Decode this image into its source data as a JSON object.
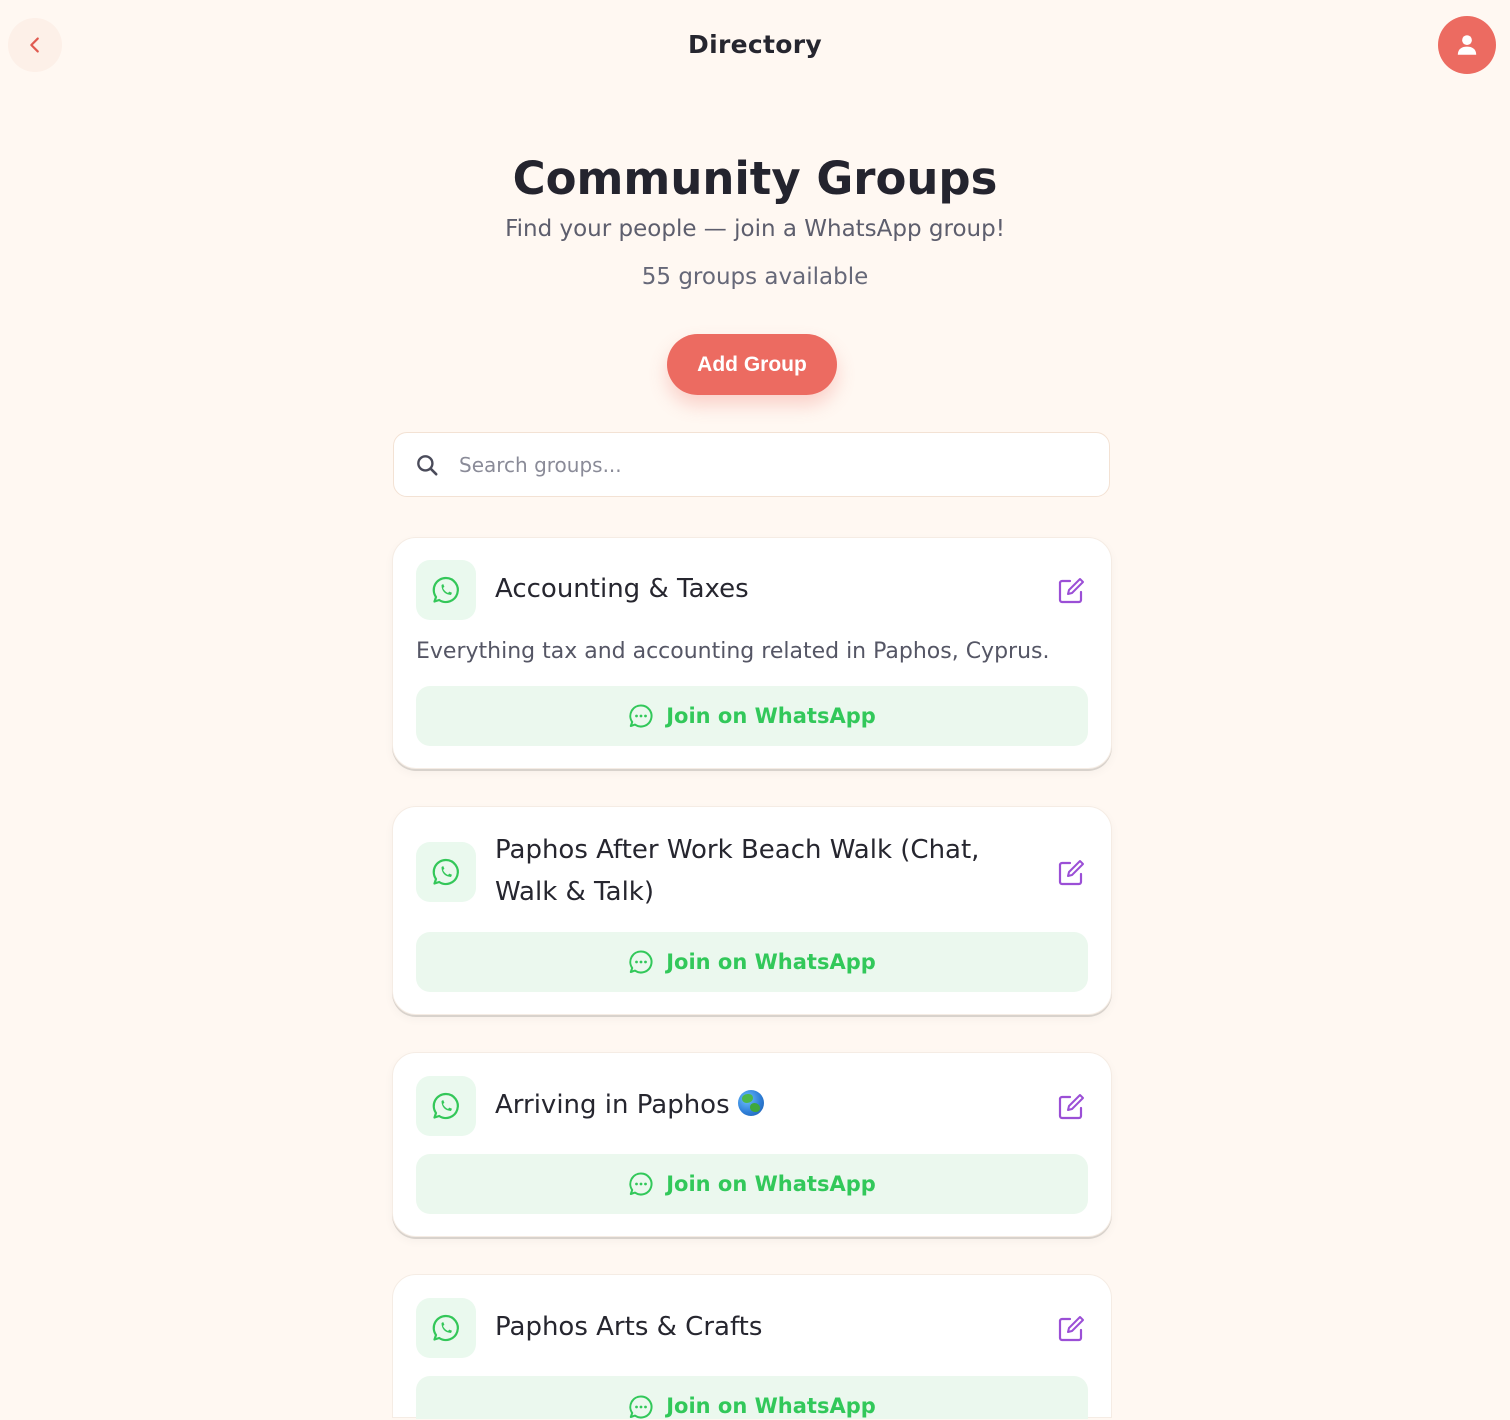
{
  "header": {
    "title": "Directory",
    "back_icon": "chevron-left-icon",
    "avatar_icon": "user-icon"
  },
  "hero": {
    "title": "Community Groups",
    "subtitle": "Find your people — join a WhatsApp group!",
    "count_text": "55 groups available",
    "add_button_label": "Add Group"
  },
  "search": {
    "placeholder": "Search groups...",
    "value": ""
  },
  "groups": [
    {
      "title": "Accounting & Taxes",
      "description": "Everything tax and accounting related in Paphos, Cyprus.",
      "join_label": "Join on WhatsApp"
    },
    {
      "title": "Paphos After Work Beach Walk (Chat, Walk & Talk)",
      "join_label": "Join on WhatsApp"
    },
    {
      "title": "Arriving in Paphos",
      "emoji": "globe-emoji",
      "join_label": "Join on WhatsApp"
    },
    {
      "title": "Paphos Arts & Crafts",
      "join_label": "Join on WhatsApp"
    }
  ],
  "colors": {
    "background": "#fff8f2",
    "accent": "#ec6b61",
    "whatsapp_green": "#32c85a",
    "edit_purple": "#9b4fd6"
  }
}
